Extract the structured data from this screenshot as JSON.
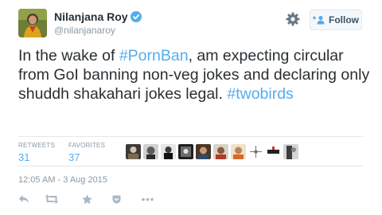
{
  "user": {
    "name": "Nilanjana Roy",
    "handle": "@nilanjanaroy"
  },
  "follow_label": "Follow",
  "tweet": {
    "text_parts": [
      {
        "type": "text",
        "value": "In the wake of "
      },
      {
        "type": "hashtag",
        "value": "#PornBan"
      },
      {
        "type": "text",
        "value": ", am expecting circular from GoI banning non-veg jokes and declaring only shuddh shakahari jokes legal. "
      },
      {
        "type": "hashtag",
        "value": "#twobirds"
      }
    ]
  },
  "stats": {
    "retweets_label": "RETWEETS",
    "retweets_value": "31",
    "favorites_label": "FAVORITES",
    "favorites_value": "37"
  },
  "timestamp": "12:05 AM - 3 Aug 2015",
  "icons": {
    "verified": "verified-badge-icon",
    "settings": "gear-icon",
    "follow": "add-user-icon",
    "reply": "reply-icon",
    "retweet": "retweet-icon",
    "favorite": "star-icon",
    "save": "pocket-icon",
    "more": "more-icon"
  },
  "colors": {
    "link": "#55acee",
    "secondary_text": "#8899a6",
    "action_gray": "#aab8c2"
  }
}
